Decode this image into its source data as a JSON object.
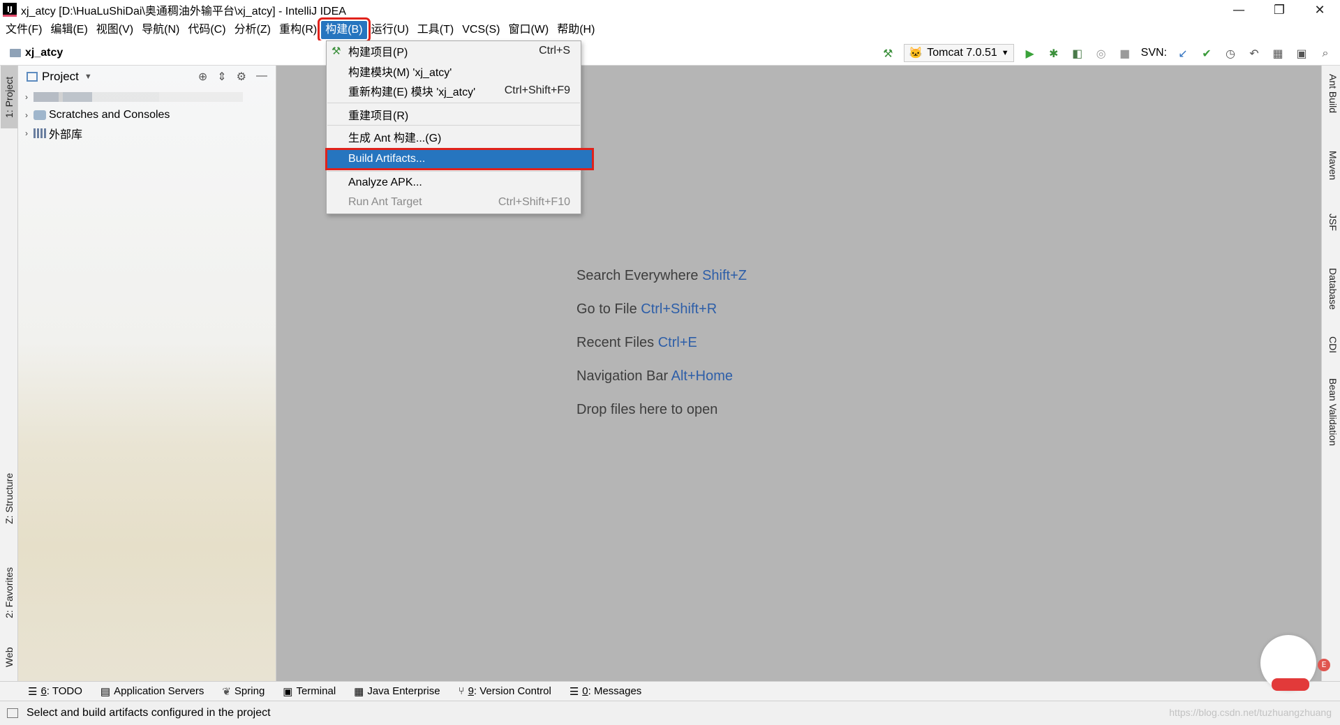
{
  "window": {
    "title": "xj_atcy [D:\\HuaLuShiDai\\奥通稠油外输平台\\xj_atcy] - IntelliJ IDEA",
    "app_icon_text": "IJ",
    "minimize": "—",
    "restore": "❐",
    "close": "✕"
  },
  "menubar": {
    "items": [
      "文件(F)",
      "编辑(E)",
      "视图(V)",
      "导航(N)",
      "代码(C)",
      "分析(Z)",
      "重构(R)",
      "构建(B)",
      "运行(U)",
      "工具(T)",
      "VCS(S)",
      "窗口(W)",
      "帮助(H)"
    ],
    "active_index": 7
  },
  "navbar": {
    "breadcrumb": "xj_atcy",
    "run_config": "Tomcat 7.0.51",
    "svn_label": "SVN:"
  },
  "left_tabs": {
    "project": "1: Project",
    "structure": "Z: Structure",
    "favorites": "2: Favorites",
    "web": "Web"
  },
  "project_panel": {
    "title": "Project",
    "tree": [
      {
        "label": "Scratches and Consoles"
      },
      {
        "label": "外部库"
      }
    ]
  },
  "build_menu": {
    "items": [
      {
        "label": "构建项目(P)",
        "shortcut": "Ctrl+S",
        "disabled": false
      },
      {
        "label": "构建模块(M) 'xj_atcy'",
        "shortcut": "",
        "disabled": false
      },
      {
        "label": "重新构建(E) 模块 'xj_atcy'",
        "shortcut": "Ctrl+Shift+F9",
        "disabled": false
      },
      {
        "label": "重建项目(R)",
        "shortcut": "",
        "disabled": false
      },
      {
        "label": "生成 Ant 构建...(G)",
        "shortcut": "",
        "disabled": false
      },
      {
        "label": "Build Artifacts...",
        "shortcut": "",
        "disabled": false,
        "selected": true
      },
      {
        "label": "Analyze APK...",
        "shortcut": "",
        "disabled": false
      },
      {
        "label": "Run Ant Target",
        "shortcut": "Ctrl+Shift+F10",
        "disabled": true
      }
    ]
  },
  "editor_hints": [
    {
      "text": "Search Everywhere",
      "key": "Shift+Z"
    },
    {
      "text": "Go to File",
      "key": "Ctrl+Shift+R"
    },
    {
      "text": "Recent Files",
      "key": "Ctrl+E"
    },
    {
      "text": "Navigation Bar",
      "key": "Alt+Home"
    },
    {
      "text": "Drop files here to open",
      "key": ""
    }
  ],
  "right_tabs": [
    "Ant Build",
    "Maven",
    "JSF",
    "Database",
    "CDI",
    "Bean Validation"
  ],
  "bottom_tools": [
    {
      "num": "6",
      "label": ": TODO"
    },
    {
      "num": "",
      "label": "Application Servers"
    },
    {
      "num": "",
      "label": "Spring"
    },
    {
      "num": "",
      "label": "Terminal"
    },
    {
      "num": "",
      "label": "Java Enterprise"
    },
    {
      "num": "9",
      "label": ": Version Control"
    },
    {
      "num": "0",
      "label": ": Messages"
    }
  ],
  "statusbar": {
    "text": "Select and build artifacts configured in the project",
    "watermark": "https://blog.csdn.net/tuzhuangzhuang"
  },
  "mascot": {
    "badge": "E"
  }
}
